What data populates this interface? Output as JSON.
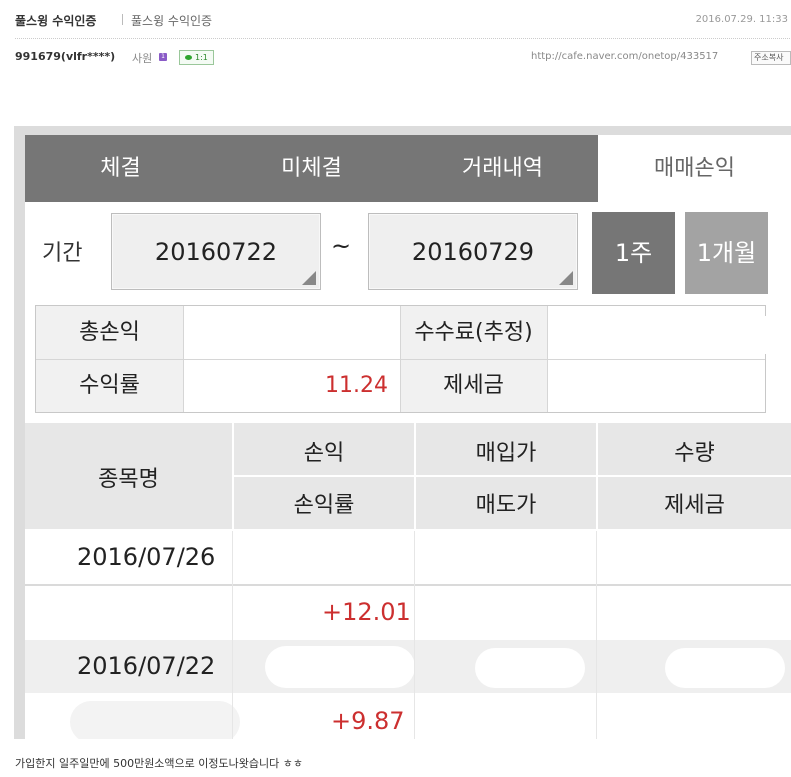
{
  "post": {
    "title": "풀스윙 수익인증",
    "category": "풀스윙 수익인증",
    "date": "2016.07.29. 11:33",
    "author": "991679(vlfr****)",
    "rank": "사원",
    "rank_badge": "1",
    "comment_badge": "1:1",
    "url": "http://cafe.naver.com/onetop/433517",
    "copy_label": "주소복사",
    "caption": "가입한지 일주일만에 500만원소액으로 이정도나왓습니다 ㅎㅎ"
  },
  "app": {
    "tabs": [
      {
        "label": "체결"
      },
      {
        "label": "미체결"
      },
      {
        "label": "거래내역"
      },
      {
        "label": "매매손익"
      }
    ],
    "period": {
      "label": "기간",
      "start": "20160722",
      "separator": "~",
      "end": "20160729",
      "btn_week": "1주",
      "btn_month": "1개월"
    },
    "summary": {
      "total_pnl_label": "총손익",
      "fee_label": "수수료(추정)",
      "return_label": "수익률",
      "return_value": "11.24",
      "tax_label": "제세금"
    },
    "list_header": {
      "name": "종목명",
      "pnl": "손익",
      "buy_price": "매입가",
      "qty": "수량",
      "pnl_rate": "손익률",
      "sell_price": "매도가",
      "tax": "제세금"
    },
    "rows": [
      {
        "date": "2016/07/26",
        "rate": "+12.01"
      },
      {
        "date": "2016/07/22",
        "rate": "+9.87"
      }
    ]
  },
  "colors": {
    "tab_bg": "#767676",
    "accent_red": "#cc2f2f",
    "header_bg": "#e7e7e7"
  }
}
